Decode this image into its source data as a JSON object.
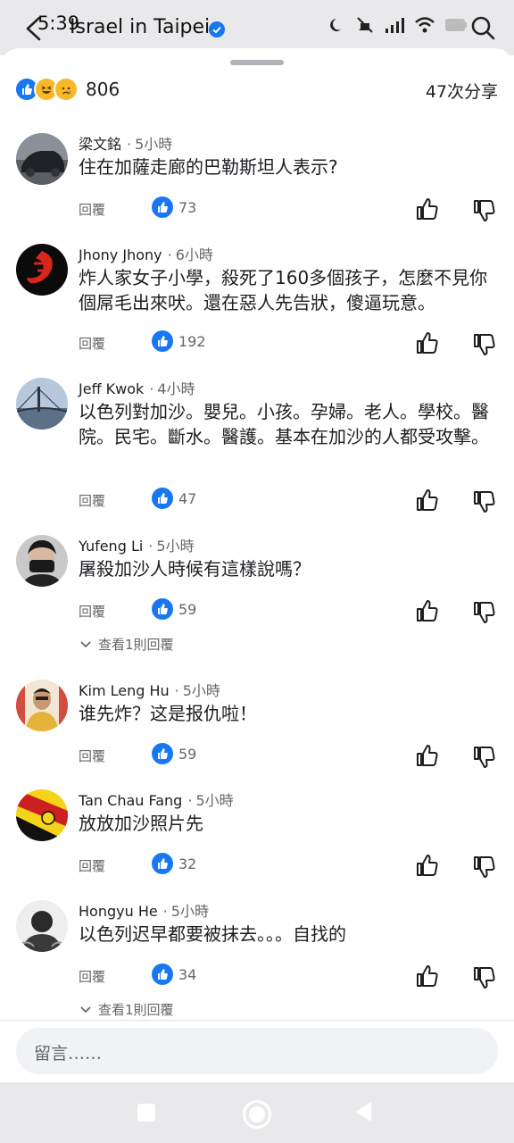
{
  "header": {
    "time": "5:39",
    "title": "Israel in Taipei"
  },
  "reactions": {
    "count": "806",
    "shares": "47次分享"
  },
  "comments": [
    {
      "name": "梁文銘",
      "time": "5小時",
      "text": "住在加薩走廊的巴勒斯坦人表示?",
      "likes": "73",
      "reply": "回覆"
    },
    {
      "name": "Jhony Jhony",
      "time": "6小時",
      "text": "炸人家女子小學，殺死了160多個孩子，怎麼不見你個屌毛出來吠。還在惡人先告狀，傻逼玩意。",
      "likes": "192",
      "reply": "回覆"
    },
    {
      "name": "Jeff Kwok",
      "time": "4小時",
      "text": "以色列對加沙。嬰兒。小孩。孕婦。老人。學校。醫院。民宅。斷水。醫護。基本在加沙的人都受攻擊。",
      "likes": "47",
      "reply": "回覆"
    },
    {
      "name": "Yufeng Li",
      "time": "5小時",
      "text": "屠殺加沙人時候有這樣說嗎？",
      "likes": "59",
      "reply": "回覆",
      "view_replies": "查看1則回覆"
    },
    {
      "name": "Kim Leng Hu",
      "time": "5小時",
      "text": "谁先炸？这是报仇啦！",
      "likes": "59",
      "reply": "回覆"
    },
    {
      "name": "Tan Chau Fang",
      "time": "5小時",
      "text": "放放加沙照片先",
      "likes": "32",
      "reply": "回覆"
    },
    {
      "name": "Hongyu He",
      "time": "5小時",
      "text": "以色列迟早都要被抹去。。。自找的",
      "likes": "34",
      "reply": "回覆",
      "view_replies": "查看1則回覆"
    }
  ],
  "composer": {
    "placeholder": "留言……"
  },
  "colors": {
    "accent": "#1877f2",
    "muted": "#65676b",
    "text": "#1c1e21"
  }
}
